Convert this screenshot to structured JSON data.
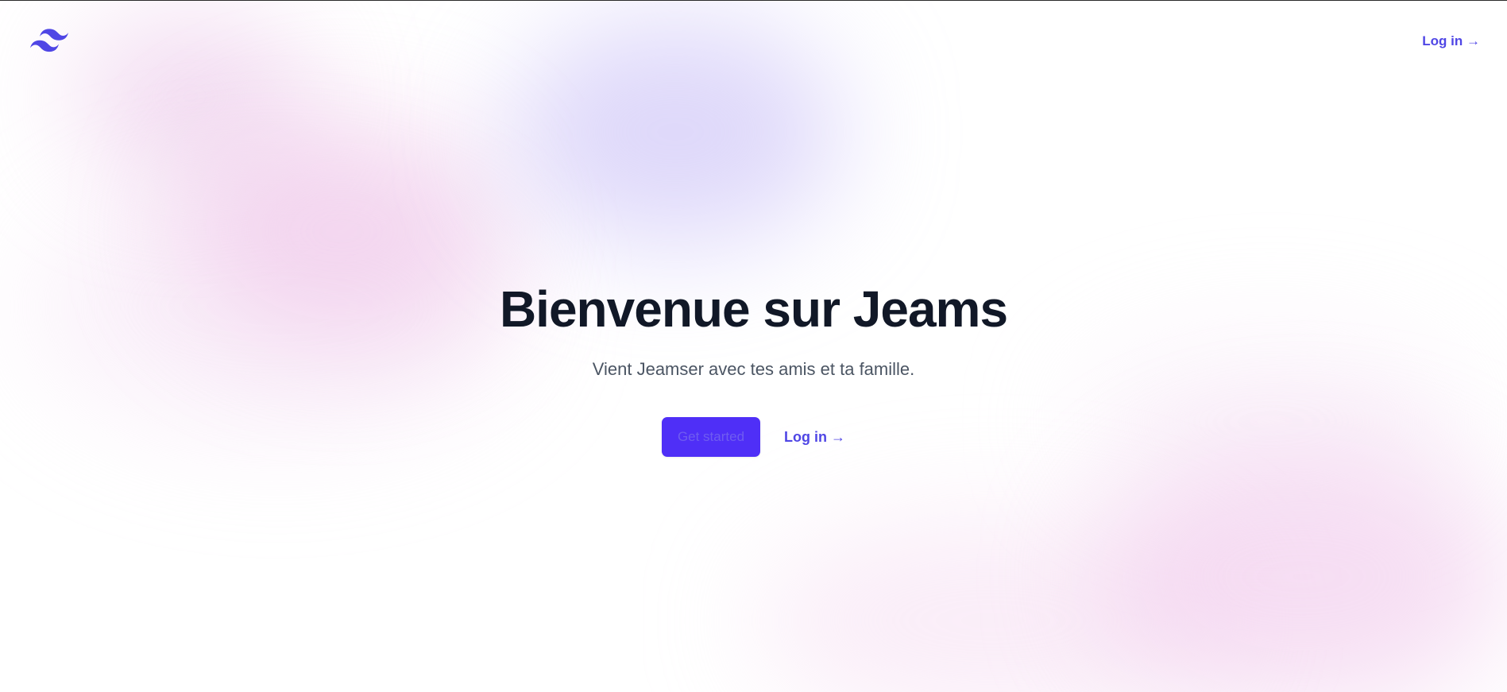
{
  "header": {
    "logo_icon": "tailwind-logo-icon",
    "login_label": "Log in →"
  },
  "hero": {
    "title": "Bienvenue sur Jeams",
    "subtitle": "Vient Jeamser avec tes amis et ta famille.",
    "primary_button_label": "Get started",
    "secondary_button_label": "Log in →"
  },
  "colors": {
    "accent": "#4f46e5",
    "primary_button_bg": "#4f2ff7",
    "title": "#111827",
    "subtitle": "#4b5563"
  }
}
